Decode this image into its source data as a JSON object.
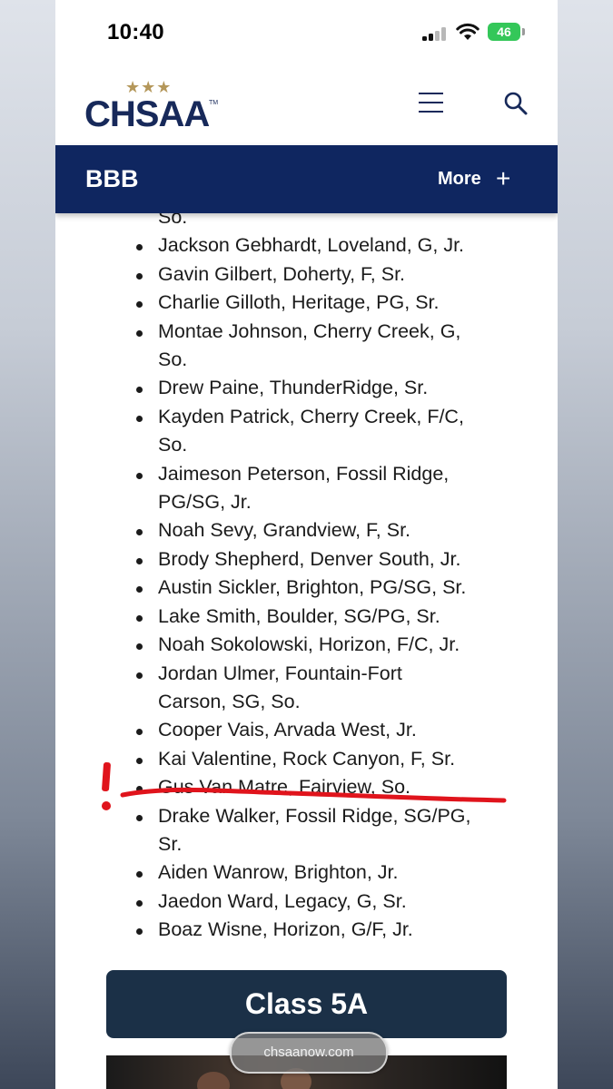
{
  "status_bar": {
    "time": "10:40",
    "battery": "46"
  },
  "header": {
    "logo_stars": "★★★",
    "logo_text": "CHSAA",
    "logo_tm": "TM"
  },
  "nav": {
    "title": "BBB",
    "more_label": "More",
    "plus_glyph": "+"
  },
  "list": {
    "items": [
      {
        "lines": [
          "So."
        ],
        "continuation": true
      },
      {
        "lines": [
          "Jackson Gebhardt, Loveland, G, Jr."
        ]
      },
      {
        "lines": [
          "Gavin Gilbert, Doherty, F, Sr."
        ]
      },
      {
        "lines": [
          "Charlie Gilloth, Heritage, PG, Sr."
        ]
      },
      {
        "lines": [
          "Montae Johnson, Cherry Creek, G,",
          "So."
        ]
      },
      {
        "lines": [
          "Drew Paine, ThunderRidge, Sr."
        ]
      },
      {
        "lines": [
          "Kayden Patrick, Cherry Creek, F/C,",
          "So."
        ]
      },
      {
        "lines": [
          "Jaimeson Peterson, Fossil Ridge,",
          "PG/SG, Jr."
        ]
      },
      {
        "lines": [
          "Noah Sevy, Grandview, F, Sr."
        ]
      },
      {
        "lines": [
          "Brody Shepherd, Denver South, Jr."
        ]
      },
      {
        "lines": [
          "Austin Sickler, Brighton, PG/SG, Sr."
        ]
      },
      {
        "lines": [
          "Lake Smith, Boulder, SG/PG, Sr."
        ]
      },
      {
        "lines": [
          "Noah Sokolowski, Horizon, F/C, Jr."
        ]
      },
      {
        "lines": [
          "Jordan Ulmer, Fountain-Fort",
          "Carson, SG, So."
        ]
      },
      {
        "lines": [
          "Cooper Vais, Arvada West, Jr."
        ]
      },
      {
        "lines": [
          "Kai Valentine, Rock Canyon, F, Sr."
        ]
      },
      {
        "lines": [
          "Gus Van Matre, Fairview, So."
        ]
      },
      {
        "lines": [
          "Drake Walker, Fossil Ridge, SG/PG,",
          "Sr."
        ]
      },
      {
        "lines": [
          "Aiden Wanrow, Brighton, Jr."
        ]
      },
      {
        "lines": [
          "Jaedon Ward, Legacy, G, Sr."
        ]
      },
      {
        "lines": [
          "Boaz Wisne, Horizon, G/F, Jr."
        ]
      }
    ]
  },
  "annotation": {
    "exclamation": "!",
    "color": "#e0141c"
  },
  "section_button": {
    "label": "Class 5A"
  },
  "browser": {
    "url": "chsaanow.com"
  },
  "colors": {
    "navy": "#0f2660",
    "gold": "#b4975a",
    "button": "#1b3047"
  }
}
